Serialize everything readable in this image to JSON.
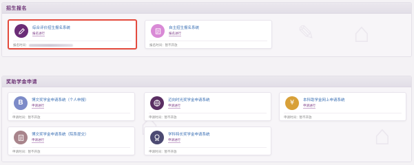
{
  "sections": [
    {
      "title": "招生报名",
      "cards": [
        {
          "title": "综合评价招生报名系统",
          "status": "报名进行",
          "time_label": "报名时间：",
          "time_value": "",
          "icon": "pencil-icon",
          "color": "#6b2d77",
          "selected": true
        },
        {
          "title": "自主招生报名系统",
          "status": "报名进行",
          "time_label": "报名时间：",
          "time_value": "暂不开放",
          "icon": "form-icon",
          "color": "#d98ad6",
          "selected": false
        }
      ]
    },
    {
      "title": "奖助学金申请",
      "cards": [
        {
          "title": "博文奖学金申请系统（个人申报）",
          "status": "申请进行",
          "time_label": "申请时间：",
          "time_value": "暂不开放",
          "icon": "letter-b-icon",
          "color": "#7d8bc8"
        },
        {
          "title": "迈向时光奖学金申请系统",
          "status": "申请进行",
          "time_label": "申请时间：",
          "time_value": "暂不开放",
          "icon": "globe-icon",
          "color": "#5a2e63"
        },
        {
          "title": "本科助学金网上申请系统",
          "status": "申请进行",
          "time_label": "申请时间：",
          "time_value": "暂不开放",
          "icon": "coin-icon",
          "color": "#d8a038"
        },
        {
          "title": "博文奖学金申请系统（院系提交）",
          "status": "申请进行",
          "time_label": "申请时间：",
          "time_value": "暂不开放",
          "icon": "document-icon",
          "color": "#a8848b"
        },
        {
          "title": "学科特长奖学金申请系统",
          "status": "申请进行",
          "time_label": "申请时间：",
          "time_value": "暂不开放",
          "icon": "medal-icon",
          "color": "#4c4a72"
        }
      ]
    }
  ]
}
